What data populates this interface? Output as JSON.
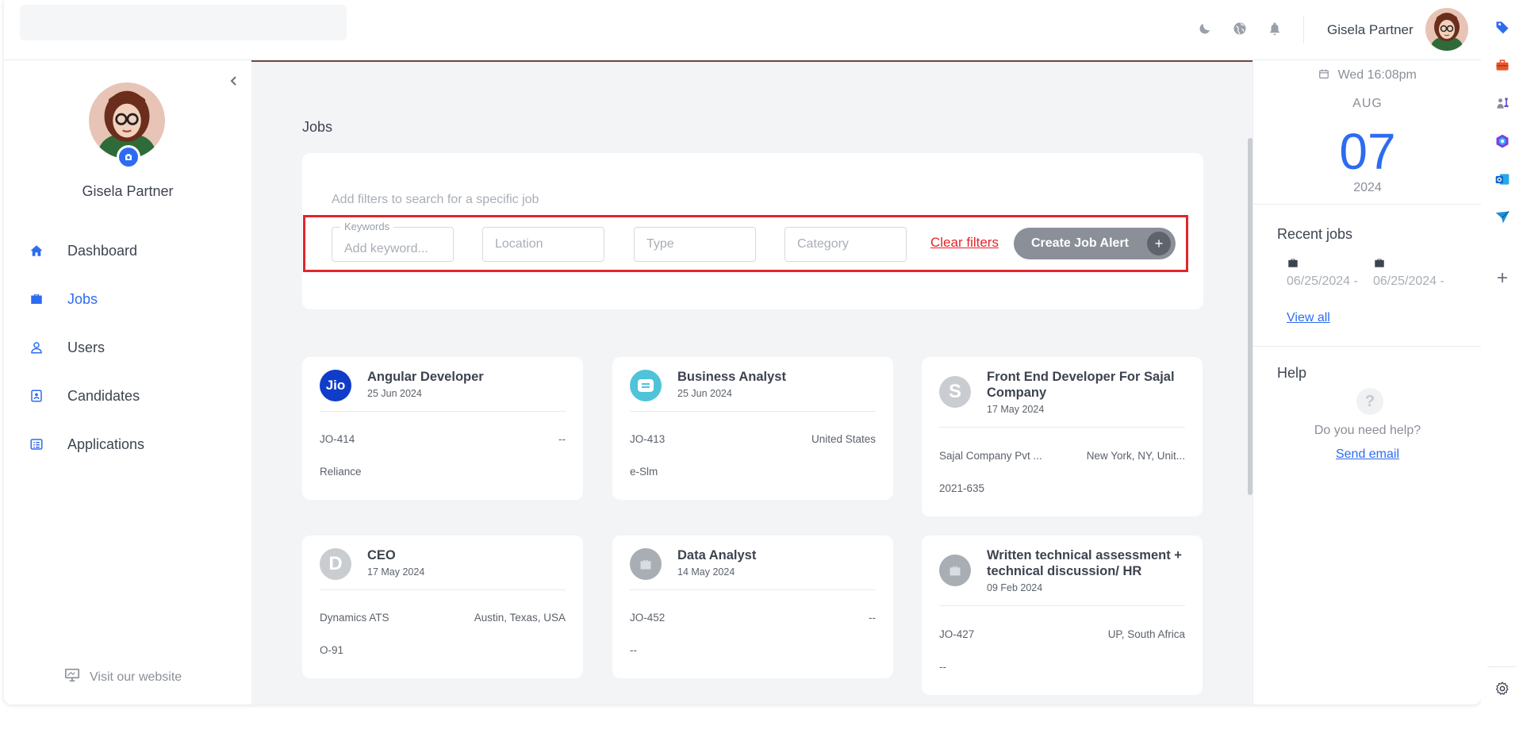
{
  "header": {
    "user_name": "Gisela Partner",
    "icons": [
      "moon-icon",
      "globe-icon",
      "bell-icon"
    ]
  },
  "sidebar": {
    "profile_name": "Gisela Partner",
    "items": [
      {
        "label": "Dashboard",
        "icon": "home-icon",
        "active": false
      },
      {
        "label": "Jobs",
        "icon": "briefcase-icon",
        "active": true
      },
      {
        "label": "Users",
        "icon": "user-icon",
        "active": false
      },
      {
        "label": "Candidates",
        "icon": "id-card-icon",
        "active": false
      },
      {
        "label": "Applications",
        "icon": "list-icon",
        "active": false
      }
    ],
    "visit_website": "Visit our website"
  },
  "main": {
    "title": "Jobs",
    "filters": {
      "hint": "Add filters to search for a specific job",
      "keywords_label": "Keywords",
      "keywords_placeholder": "Add keyword...",
      "location_placeholder": "Location",
      "type_placeholder": "Type",
      "category_placeholder": "Category",
      "clear_label": "Clear filters",
      "create_alert_label": "Create Job Alert",
      "create_alert_icon": "+"
    },
    "jobs": [
      {
        "title": "Angular Developer",
        "date": "25 Jun 2024",
        "code": "JO-414",
        "location": "--",
        "company": "Reliance",
        "logo": "jio-logo"
      },
      {
        "title": "Business Analyst",
        "date": "25 Jun 2024",
        "code": "JO-413",
        "location": "United States",
        "company": "e-Slm",
        "logo": "teal-company-logo"
      },
      {
        "title": "Front End Developer For Sajal Company",
        "date": "17 May 2024",
        "code": "Sajal Company Pvt ...",
        "location": "New York, NY, Unit...",
        "company": "2021-635",
        "logo": "letter-s-logo",
        "logo_letter": "S"
      },
      {
        "title": "CEO",
        "date": "17 May 2024",
        "code": "Dynamics ATS",
        "location": "Austin, Texas, USA",
        "company": "O-91",
        "logo": "letter-d-logo",
        "logo_letter": "D"
      },
      {
        "title": "Data Analyst",
        "date": "14 May 2024",
        "code": "JO-452",
        "location": "--",
        "company": "--",
        "logo": "briefcase-logo"
      },
      {
        "title": "Written technical assessment + technical discussion/ HR",
        "date": "09 Feb 2024",
        "code": "JO-427",
        "location": "UP, South Africa",
        "company": "--",
        "logo": "briefcase-logo"
      }
    ]
  },
  "right_panel": {
    "datetime": "Wed 16:08pm",
    "month": "AUG",
    "day": "07",
    "year": "2024",
    "recent_title": "Recent jobs",
    "recent_items": [
      {
        "date": "06/25/2024 -"
      },
      {
        "date": "06/25/2024 -"
      }
    ],
    "view_all": "View all",
    "help_title": "Help",
    "help_icon": "?",
    "help_question": "Do you need help?",
    "send_email": "Send email"
  },
  "dock": {
    "icons": [
      "tag-icon",
      "toolbox-icon",
      "chess-icon",
      "copilot-icon",
      "outlook-icon",
      "send-icon",
      "plus-icon",
      "settings-icon"
    ]
  },
  "colors": {
    "accent": "#2d6cf0",
    "highlight": "#e3242b",
    "button_gray": "#8a8f98"
  }
}
